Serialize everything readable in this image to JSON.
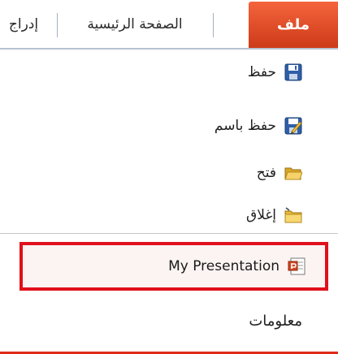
{
  "ribbon": {
    "tabs": {
      "file": "ملف",
      "home": "الصفحة الرئيسية",
      "insert": "إدراج"
    },
    "file_tab_color": "#e04a22"
  },
  "backstage": {
    "items": {
      "save": {
        "label": "حفظ",
        "icon": "floppy-disk-icon"
      },
      "save_as": {
        "label": "حفظ باسم",
        "icon": "save-as-icon"
      },
      "open": {
        "label": "فتح",
        "icon": "open-folder-icon"
      },
      "close": {
        "label": "إغلاق",
        "icon": "close-folder-icon"
      }
    },
    "recent_document": {
      "label": "My Presentation",
      "icon": "powerpoint-file-icon"
    },
    "info": {
      "label": "معلومات"
    },
    "highlight_color": "#e0101c"
  }
}
